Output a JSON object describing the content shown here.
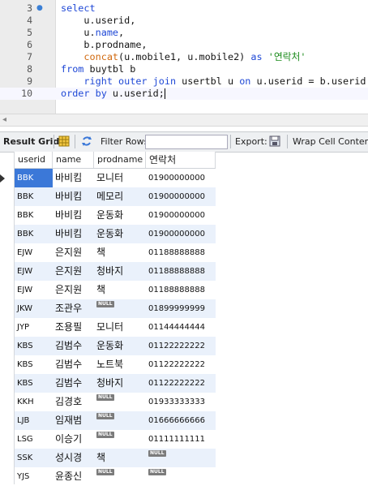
{
  "editor": {
    "lines": [
      {
        "num": "3",
        "marker": true,
        "parts": [
          [
            "kw",
            "select"
          ]
        ]
      },
      {
        "num": "4",
        "marker": false,
        "parts": [
          [
            "tx",
            "    u.userid,"
          ]
        ]
      },
      {
        "num": "5",
        "marker": false,
        "parts": [
          [
            "tx",
            "    u."
          ],
          [
            "kw",
            "name"
          ],
          [
            "tx",
            ","
          ]
        ]
      },
      {
        "num": "6",
        "marker": false,
        "parts": [
          [
            "tx",
            "    b.prodname,"
          ]
        ]
      },
      {
        "num": "7",
        "marker": false,
        "parts": [
          [
            "fn",
            "    concat"
          ],
          [
            "tx",
            "(u.mobile1, u.mobile2) "
          ],
          [
            "kw",
            "as"
          ],
          [
            "tx",
            " "
          ],
          [
            "str",
            "'연락처'"
          ]
        ]
      },
      {
        "num": "8",
        "marker": false,
        "parts": [
          [
            "kw",
            "from"
          ],
          [
            "tx",
            " buytbl b"
          ]
        ]
      },
      {
        "num": "9",
        "marker": false,
        "parts": [
          [
            "kw",
            "    right outer join"
          ],
          [
            "tx",
            " usertbl u "
          ],
          [
            "kw",
            "on"
          ],
          [
            "tx",
            " u.userid = b.userid"
          ]
        ]
      },
      {
        "num": "10",
        "marker": false,
        "parts": [
          [
            "kw",
            "order by"
          ],
          [
            "tx",
            " u.userid;"
          ]
        ]
      }
    ]
  },
  "toolbar": {
    "result_grid": "Result Grid",
    "filter_rows": "Filter Rows:",
    "filter_value": "",
    "export": "Export:",
    "wrap": "Wrap Cell Content:"
  },
  "grid": {
    "columns": [
      "userid",
      "name",
      "prodname",
      "연락처"
    ],
    "null_label": "NULL",
    "rows": [
      [
        "BBK",
        "바비킴",
        "모니터",
        "01900000000"
      ],
      [
        "BBK",
        "바비킴",
        "메모리",
        "01900000000"
      ],
      [
        "BBK",
        "바비킴",
        "운동화",
        "01900000000"
      ],
      [
        "BBK",
        "바비킴",
        "운동화",
        "01900000000"
      ],
      [
        "EJW",
        "은지원",
        "책",
        "01188888888"
      ],
      [
        "EJW",
        "은지원",
        "청바지",
        "01188888888"
      ],
      [
        "EJW",
        "은지원",
        "책",
        "01188888888"
      ],
      [
        "JKW",
        "조관우",
        null,
        "01899999999"
      ],
      [
        "JYP",
        "조용필",
        "모니터",
        "01144444444"
      ],
      [
        "KBS",
        "김범수",
        "운동화",
        "01122222222"
      ],
      [
        "KBS",
        "김범수",
        "노트북",
        "01122222222"
      ],
      [
        "KBS",
        "김범수",
        "청바지",
        "01122222222"
      ],
      [
        "KKH",
        "김경호",
        null,
        "01933333333"
      ],
      [
        "LJB",
        "임재범",
        null,
        "01666666666"
      ],
      [
        "LSG",
        "이승기",
        null,
        "01111111111"
      ],
      [
        "SSK",
        "성시경",
        "책",
        null
      ],
      [
        "YJS",
        "윤종신",
        null,
        null
      ]
    ]
  },
  "colors": {
    "keyword": "#1f48d6",
    "function": "#d16a10",
    "string": "#1a8a1a",
    "selection": "#3b78d8",
    "alt_row": "#eaf1fb"
  }
}
